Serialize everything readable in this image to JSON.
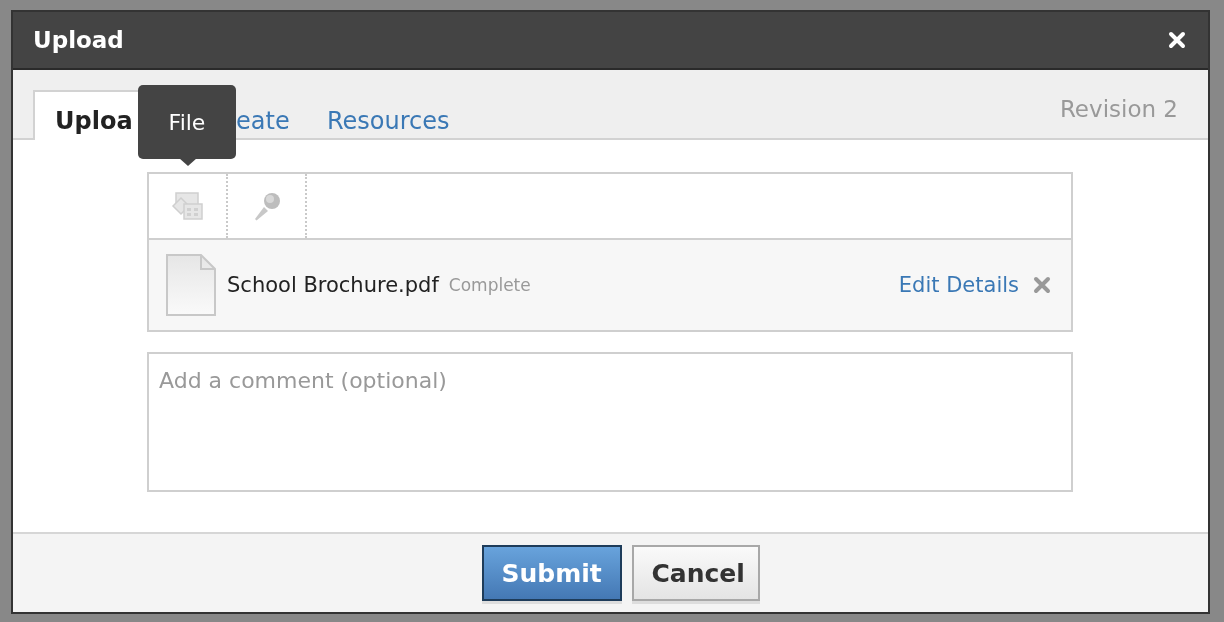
{
  "dialog": {
    "title": "Upload"
  },
  "tabs": [
    {
      "label": "Uploa",
      "selected": true
    },
    {
      "label": "eate",
      "selected": false
    },
    {
      "label": "Resources",
      "selected": false
    }
  ],
  "revision": "Revision 2",
  "tooltip": "File",
  "tools": [
    {
      "kind": "file"
    },
    {
      "kind": "microphone"
    }
  ],
  "files": [
    {
      "name": "School Brochure.pdf",
      "status": "Complete",
      "action": "Edit Details"
    }
  ],
  "comment": {
    "placeholder": "Add a comment (optional)"
  },
  "buttons": [
    {
      "label": "Submit",
      "kind": "primary"
    },
    {
      "label": "Cancel",
      "kind": "secondary"
    }
  ]
}
